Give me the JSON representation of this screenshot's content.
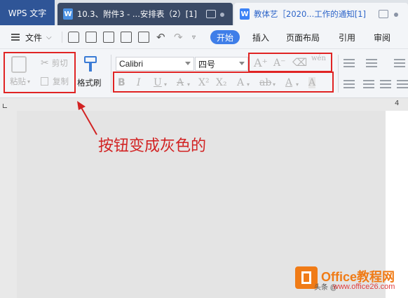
{
  "tabs": {
    "app": "WPS 文字",
    "doc1": "10.3、附件3 - ...安排表（2）[1]",
    "doc2": "教体艺［2020...工作的通知[1]",
    "doc_icon": "W"
  },
  "menu": {
    "file": "文件",
    "tabs": [
      "开始",
      "插入",
      "页面布局",
      "引用",
      "审阅"
    ]
  },
  "ribbon": {
    "paste": "粘贴",
    "cut": "剪切",
    "copy": "复制",
    "format_painter": "格式刷",
    "font_name": "Calibri",
    "font_size": "四号",
    "grow_font": "A⁺",
    "shrink_font": "A⁻",
    "phonetic": "wén",
    "bold": "B",
    "italic": "I",
    "underline": "U",
    "strike": "A",
    "superscript": "X²",
    "subscript": "X₂",
    "text_effect": "A",
    "highlight": "ab",
    "font_color": "A",
    "char_shading": "A"
  },
  "ruler": {
    "number": "4"
  },
  "annotation": {
    "text": "按钮变成灰色的"
  },
  "watermark": {
    "brand": "Office教程网",
    "sub_left": "头条 @",
    "sub_right": "www.office26.com"
  },
  "colors": {
    "accent": "#3f7ee8",
    "annotation_red": "#d22323",
    "disabled_gray": "#b5b5b5",
    "app_tab": "#2f5597"
  }
}
